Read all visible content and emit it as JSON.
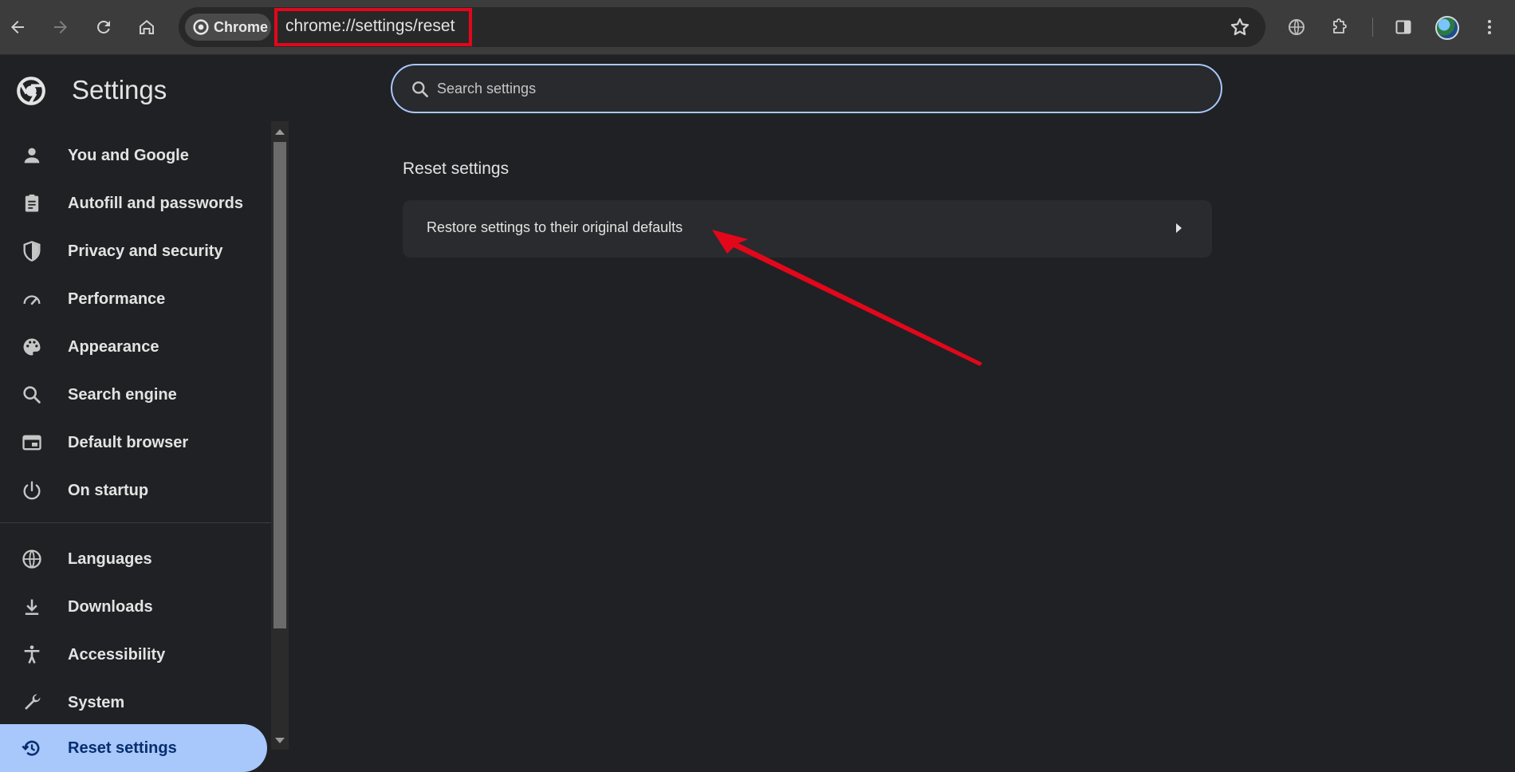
{
  "browser": {
    "chip_label": "Chrome",
    "url": "chrome://settings/reset",
    "icons": [
      "back-arrow-icon",
      "forward-arrow-icon",
      "reload-icon",
      "home-icon",
      "bookmark-star-icon",
      "globe-icon",
      "extensions-icon",
      "side-panel-icon",
      "profile-avatar",
      "more-vert-icon"
    ]
  },
  "settings": {
    "title": "Settings",
    "search_placeholder": "Search settings"
  },
  "sidebar": {
    "items": [
      {
        "label": "You and Google",
        "icon": "person-icon"
      },
      {
        "label": "Autofill and passwords",
        "icon": "clipboard-icon"
      },
      {
        "label": "Privacy and security",
        "icon": "shield-icon"
      },
      {
        "label": "Performance",
        "icon": "speedometer-icon"
      },
      {
        "label": "Appearance",
        "icon": "palette-icon"
      },
      {
        "label": "Search engine",
        "icon": "search-icon"
      },
      {
        "label": "Default browser",
        "icon": "browser-window-icon"
      },
      {
        "label": "On startup",
        "icon": "power-icon"
      },
      {
        "label": "Languages",
        "icon": "globe-icon"
      },
      {
        "label": "Downloads",
        "icon": "download-icon"
      },
      {
        "label": "Accessibility",
        "icon": "accessibility-icon"
      },
      {
        "label": "System",
        "icon": "wrench-icon"
      },
      {
        "label": "Reset settings",
        "icon": "history-icon",
        "active": true
      }
    ]
  },
  "main": {
    "section_title": "Reset settings",
    "restore_label": "Restore settings to their original defaults"
  },
  "colors": {
    "background": "#202124",
    "toolbar": "#3c3c3c",
    "active_nav": "#a8c7fa",
    "annotation_red": "#e2071b"
  }
}
